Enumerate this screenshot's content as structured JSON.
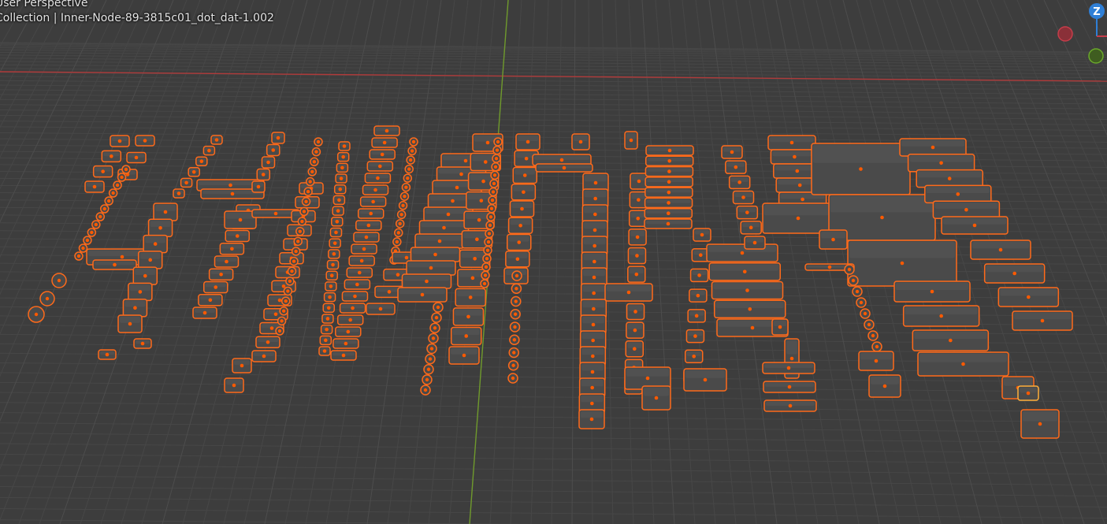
{
  "viewport": {
    "view_name": "User Perspective",
    "selection_info": "Collection | Inner-Node-89-3815c01_dot_dat-1.002"
  },
  "gizmo": {
    "z_label": "Z",
    "axes": [
      {
        "name": "z-axis",
        "color": "#2f7fd6"
      },
      {
        "name": "x-axis",
        "color": "#c63d4a"
      },
      {
        "name": "y-axis",
        "color": "#6aa82a"
      }
    ]
  },
  "colors": {
    "background": "#3d3d3d",
    "grid_minor": "#474747",
    "grid_major": "#4d4d4d",
    "x_axis_line": "#b03a3a",
    "y_axis_line": "#6f9a2c",
    "selected_outline": "#ff6a1a",
    "active_outline": "#ffae3a",
    "object_fill": "#4a4a4a",
    "object_top": "#585858",
    "origin_dot": "#ff5a00"
  }
}
